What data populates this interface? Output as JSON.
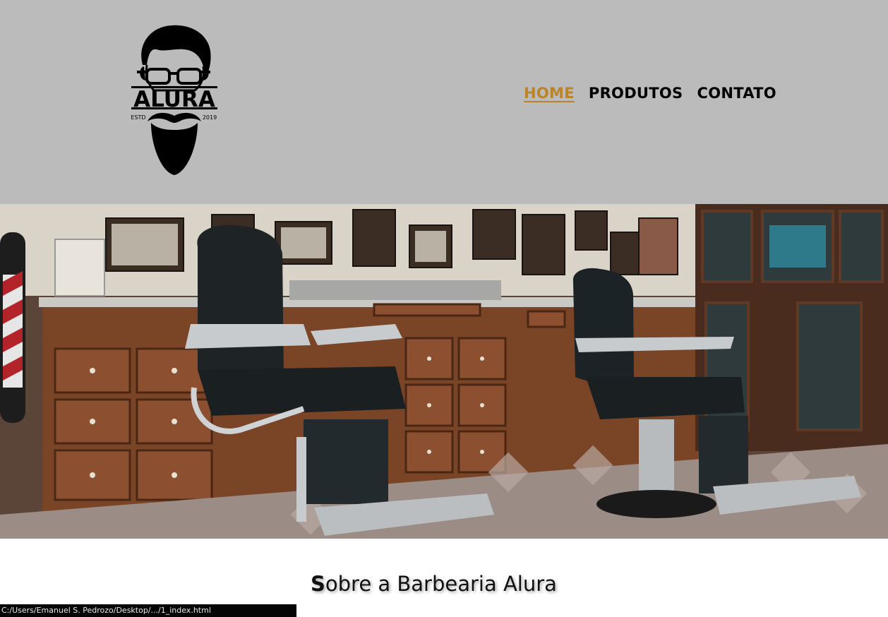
{
  "header": {
    "background_color": "#bbbbbb",
    "logo": {
      "icon": "bearded-man-glasses-logo",
      "brand_text": "ALURA",
      "estd_label": "ESTD",
      "year": "2019"
    },
    "nav": {
      "active_color": "#bc8429",
      "items": [
        {
          "label": "HOME",
          "active": true
        },
        {
          "label": "PRODUTOS",
          "active": false
        },
        {
          "label": "CONTATO",
          "active": false
        }
      ]
    }
  },
  "banner": {
    "image_subject": "barbershop-interior-with-two-barber-chairs"
  },
  "about": {
    "title_first_letter": "S",
    "title_rest": "obre a Barbearia Alura"
  },
  "status_bar": {
    "url_text": "C:/Users/Emanuel S. Pedrozo/Desktop/.../1_index.html"
  }
}
